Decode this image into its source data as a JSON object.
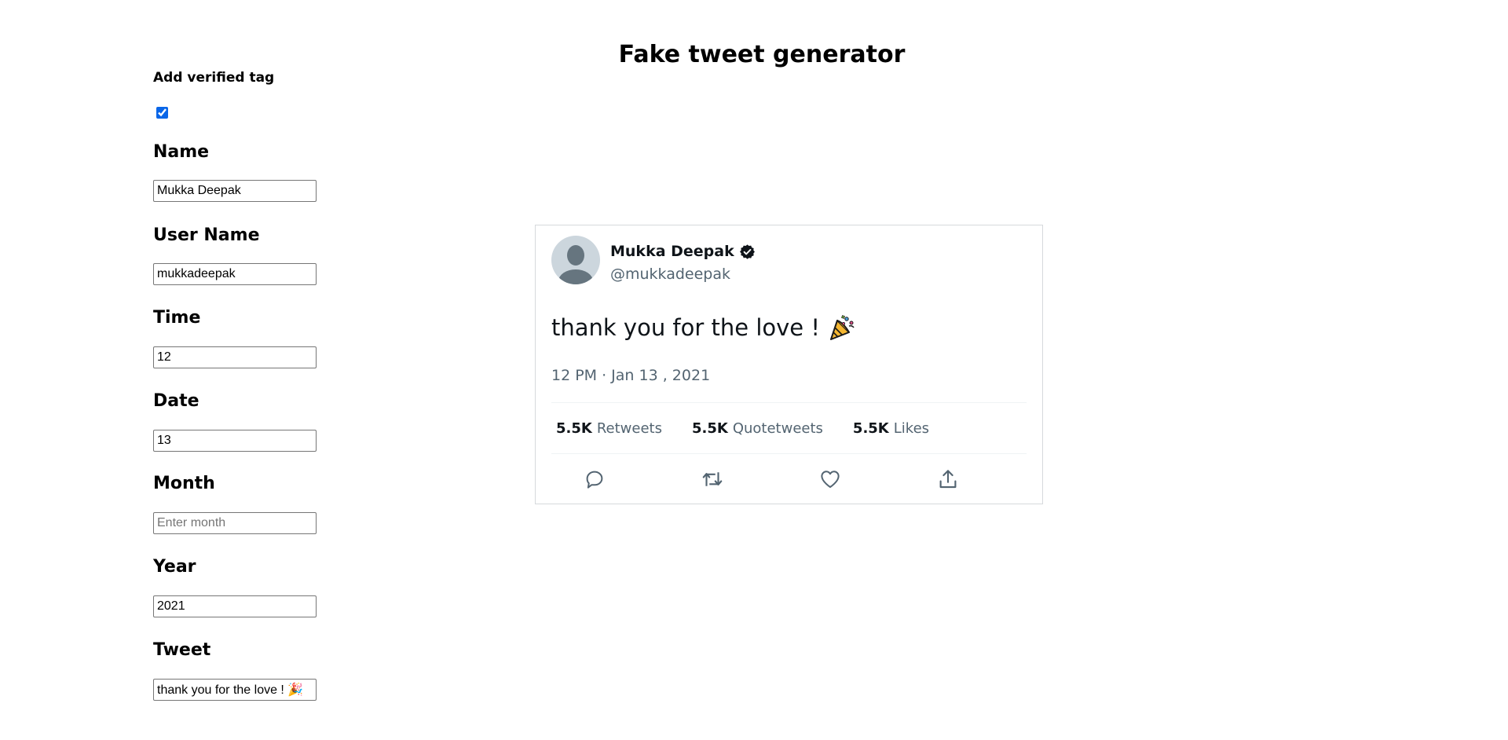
{
  "page": {
    "title": "Fake tweet generator"
  },
  "form": {
    "verified_label": "Add verified tag",
    "verified_checked": true,
    "fields": {
      "name": {
        "label": "Name",
        "value": "Mukka Deepak",
        "placeholder": ""
      },
      "username": {
        "label": "User Name",
        "value": "mukkadeepak",
        "placeholder": ""
      },
      "time": {
        "label": "Time",
        "value": "12",
        "placeholder": ""
      },
      "date": {
        "label": "Date",
        "value": "13",
        "placeholder": ""
      },
      "month": {
        "label": "Month",
        "value": "",
        "placeholder": "Enter month"
      },
      "year": {
        "label": "Year",
        "value": "2021",
        "placeholder": ""
      },
      "tweet": {
        "label": "Tweet",
        "value": "thank you for the love ! 🎉",
        "placeholder": ""
      }
    }
  },
  "tweet": {
    "display_name": "Mukka Deepak",
    "handle": "@mukkadeepak",
    "text": "thank you for the love !",
    "meta": "12 PM · Jan 13 , 2021",
    "stats": [
      {
        "num": "5.5K",
        "label": "Retweets"
      },
      {
        "num": "5.5K",
        "label": "Quotetweets"
      },
      {
        "num": "5.5K",
        "label": "Likes"
      }
    ],
    "icons": {
      "avatar": "default-avatar-icon",
      "verified": "verified-badge-icon",
      "emoji": "party-popper-icon",
      "reply": "reply-icon",
      "retweet": "retweet-icon",
      "like": "heart-icon",
      "share": "share-icon"
    }
  },
  "colors": {
    "checkbox_accent": "#0a66e8",
    "secondary_text": "#536471",
    "card_border": "#d6d9dc",
    "avatar_bg": "#ccd6dd",
    "avatar_fg": "#66757f"
  }
}
